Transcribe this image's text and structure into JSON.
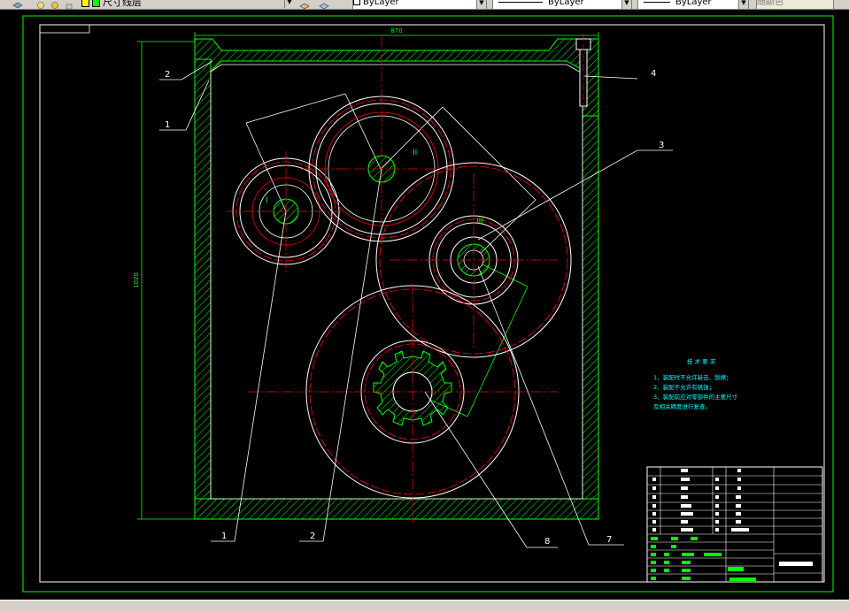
{
  "toolbar": {
    "layer_name": "尺寸线层",
    "color": "ByLayer",
    "linetype": "ByLayer",
    "lineweight": "ByLayer",
    "plotstyle": "随颜色"
  },
  "drawing": {
    "dim_width": "870",
    "dim_height": "1020",
    "dim_diag1": "",
    "dim_diag2": "",
    "dim_diag3": "",
    "callouts": {
      "c1_top": "1",
      "c2_top": "2",
      "c4": "4",
      "c3": "3",
      "c1_bottom": "1",
      "c2_bottom": "2",
      "c8": "8",
      "c7": "7"
    },
    "gear_labels": {
      "g1": "I",
      "g2": "II",
      "g3": "III"
    },
    "notes": {
      "title": "技 术 要 求",
      "line1": "1、装配时不允许敲击、刮擦；",
      "line2": "2、装配不允许有锈蚀；",
      "line3": "3、装配前应对零部件的主要尺寸",
      "line4": "及相关精度进行复查。"
    },
    "colors": {
      "frame": "#00ff00",
      "white_line": "#ffffff",
      "red_line": "#ff0000",
      "hatch": "#00ff00",
      "cyan_text": "#00ffff"
    }
  }
}
